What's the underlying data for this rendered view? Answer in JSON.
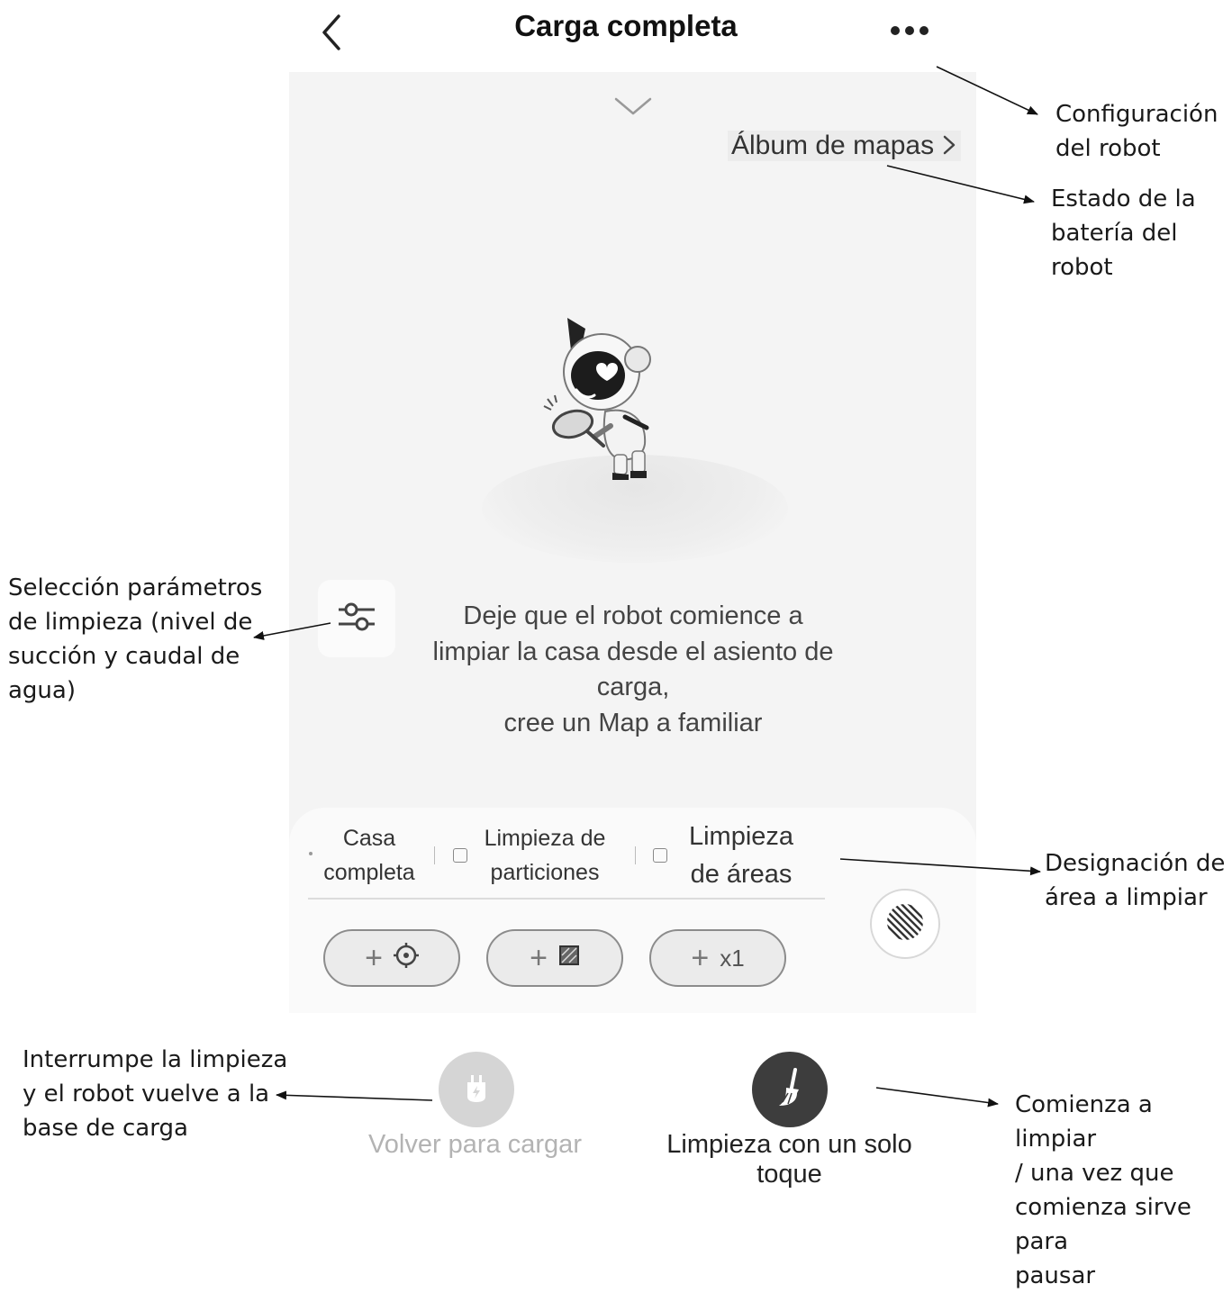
{
  "header": {
    "title": "Carga completa"
  },
  "map": {
    "album_link": "Álbum de mapas",
    "hint": "Deje que el robot comience a\nlimpiar la casa desde el asiento de\ncarga,\ncree un Map a familiar"
  },
  "modes": {
    "tabs": [
      {
        "label": "Casa\ncompleta"
      },
      {
        "label": "Limpieza de\nparticiones"
      },
      {
        "label": "Limpieza\nde áreas"
      }
    ],
    "pills": [
      {
        "icon": "target-icon"
      },
      {
        "icon": "room-icon"
      },
      {
        "label": "x1"
      }
    ]
  },
  "actions": {
    "return_label": "Volver para cargar",
    "clean_label": "Limpieza con un solo\ntoque"
  },
  "annotations": {
    "config": "Configuración\ndel robot",
    "battery": "Estado de la\nbatería del\nrobot",
    "params": "Selección parámetros\nde limpieza (nivel de\nsucción y caudal de\nagua)",
    "area": "Designación de\nárea a limpiar",
    "return": "Interrumpe la limpieza\ny el robot vuelve a la\nbase de carga",
    "start": "Comienza a limpiar\n / una vez que\ncomienza sirve para\npausar"
  },
  "colors": {
    "panel": "#f4f4f4",
    "primary_button": "#3d3d3d",
    "disabled_button": "#d5d5d5"
  }
}
